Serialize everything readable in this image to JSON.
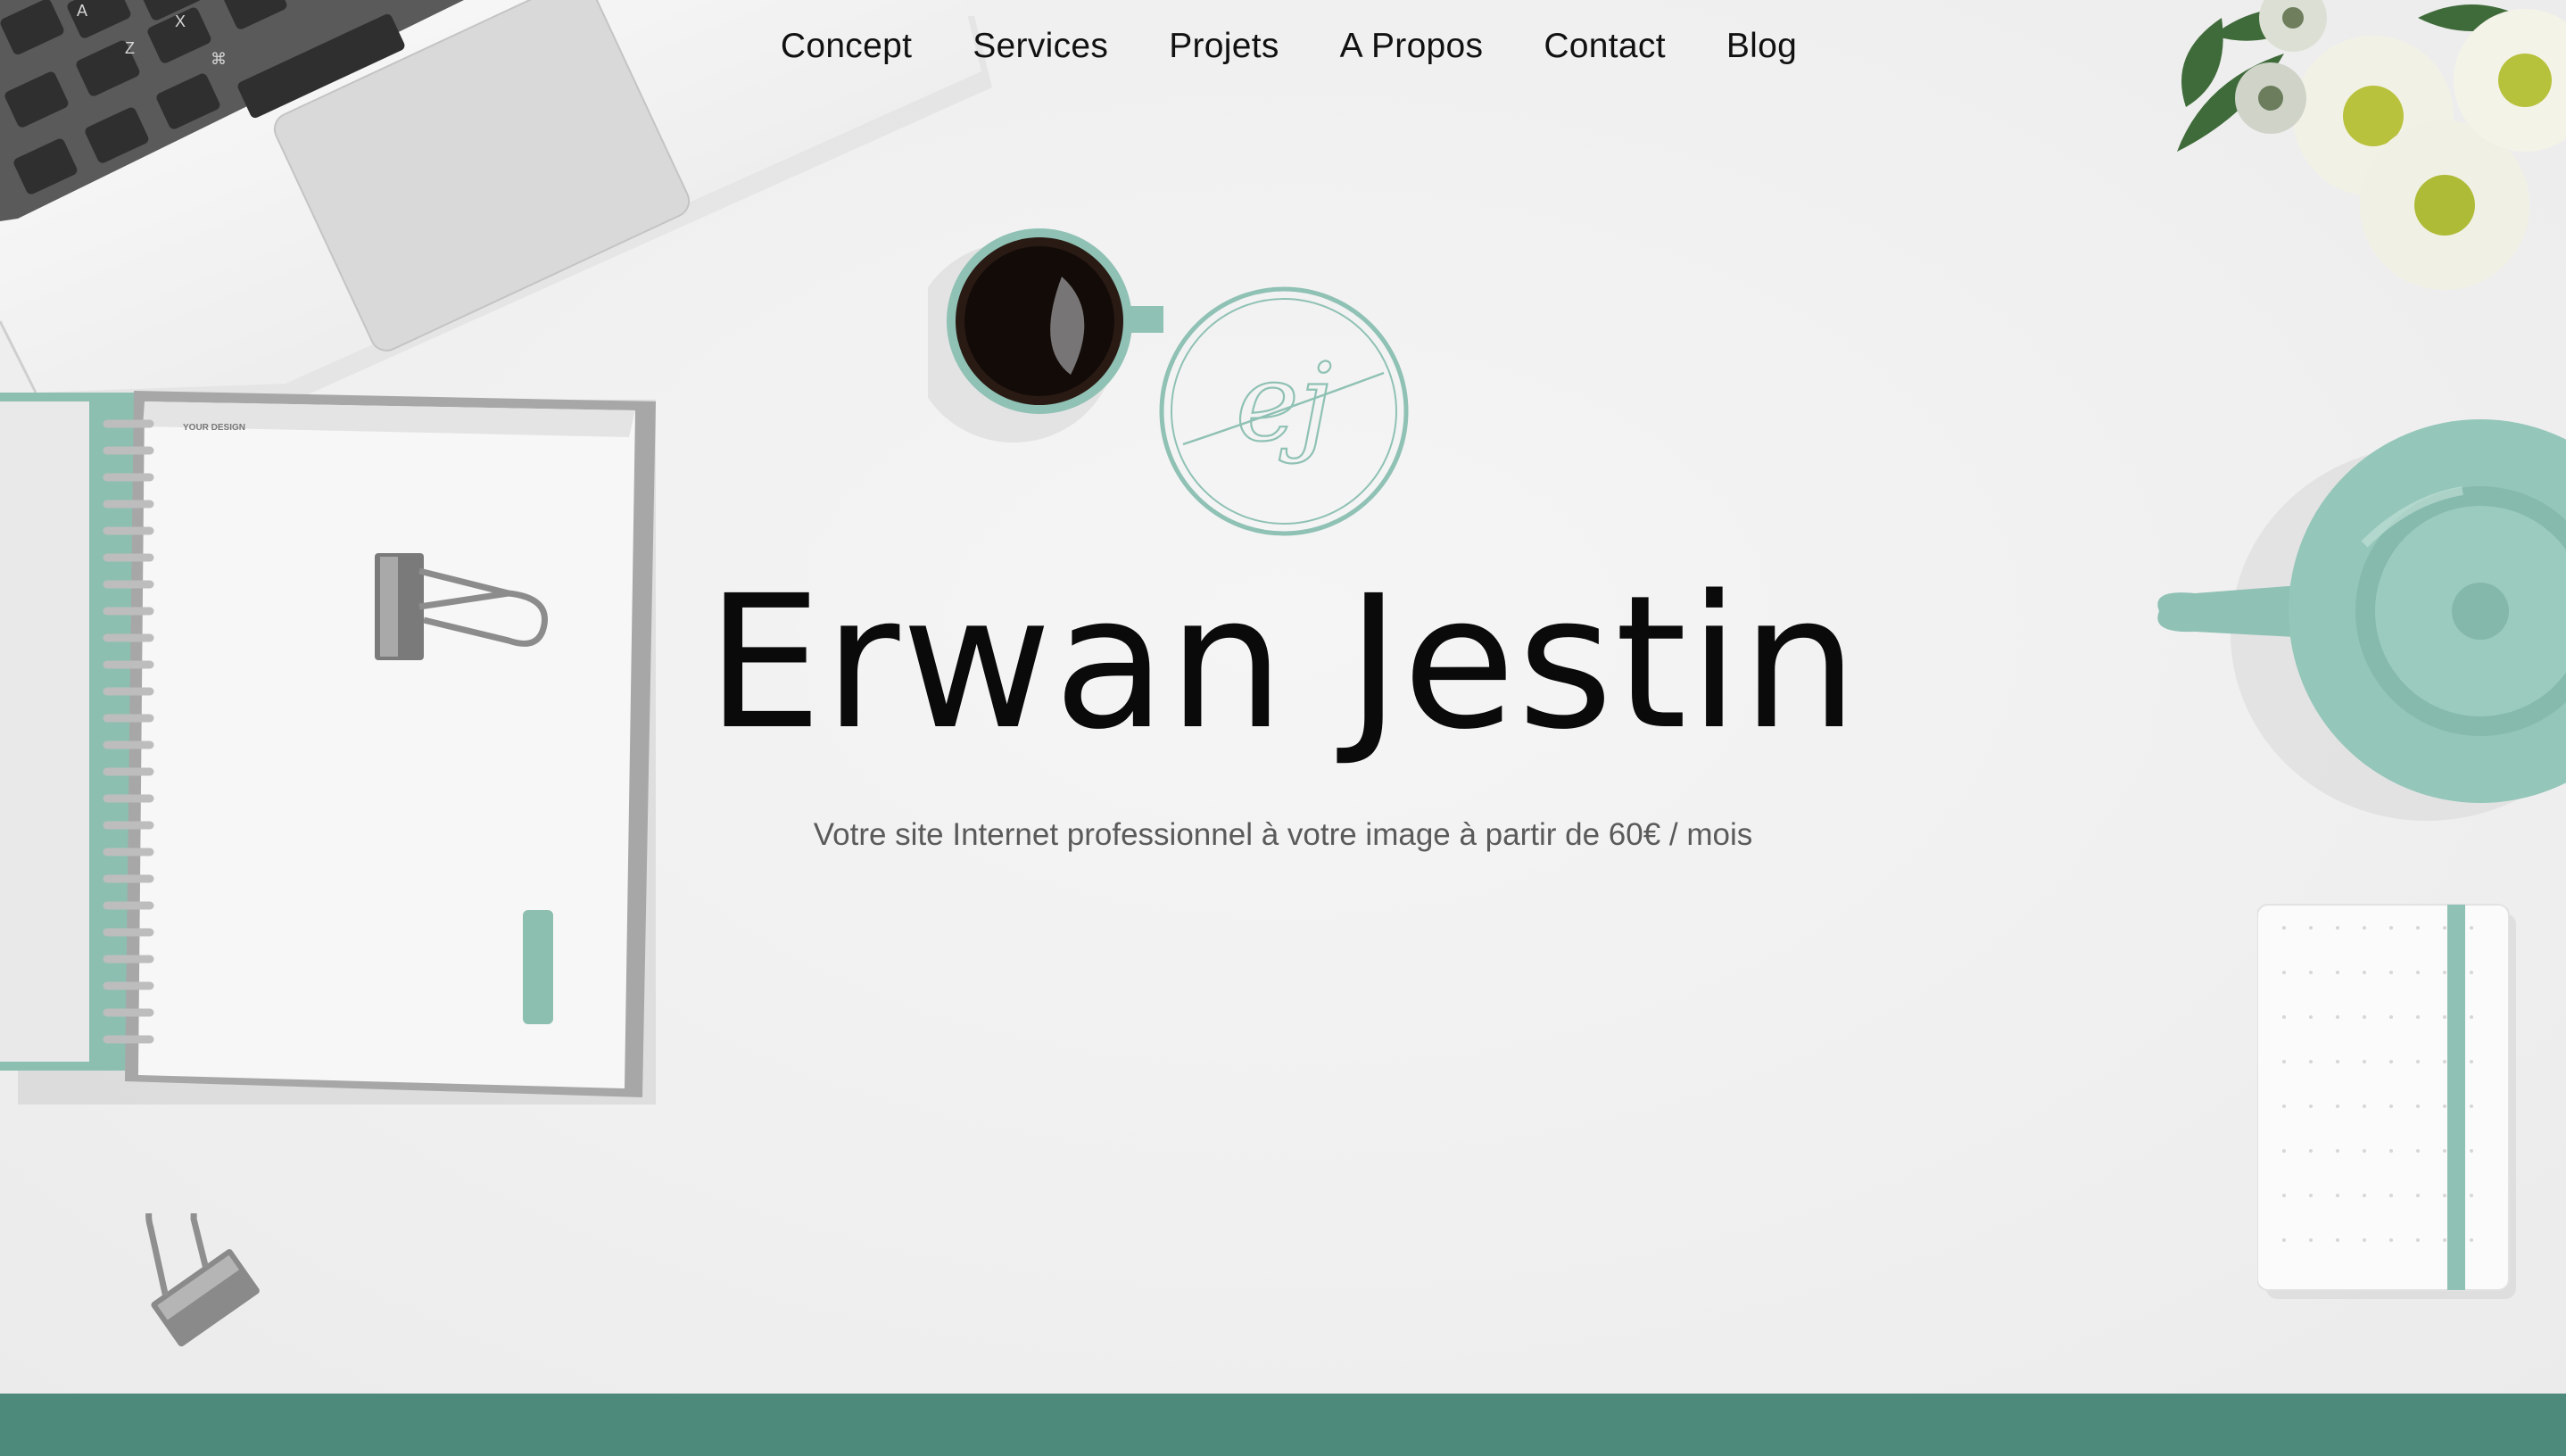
{
  "nav": {
    "items": [
      {
        "label": "Concept"
      },
      {
        "label": "Services"
      },
      {
        "label": "Projets"
      },
      {
        "label": "A Propos"
      },
      {
        "label": "Contact"
      },
      {
        "label": "Blog"
      }
    ]
  },
  "logo": {
    "text": "ej",
    "icon": "monogram-logo"
  },
  "hero": {
    "title": "Erwan Jestin",
    "subtitle": "Votre site Internet professionnel à votre image à partir de 60€ / mois"
  },
  "decor": {
    "notebook_label": "YOUR DESIGN",
    "keyboard_keys": [
      "A",
      "Z",
      "X",
      "⌘"
    ]
  },
  "colors": {
    "accent": "#4e8a7b",
    "mint": "#8fc1b4",
    "background": "#f1f1f1",
    "title": "#0a0a0a",
    "subtitle": "#5a5a5a"
  }
}
